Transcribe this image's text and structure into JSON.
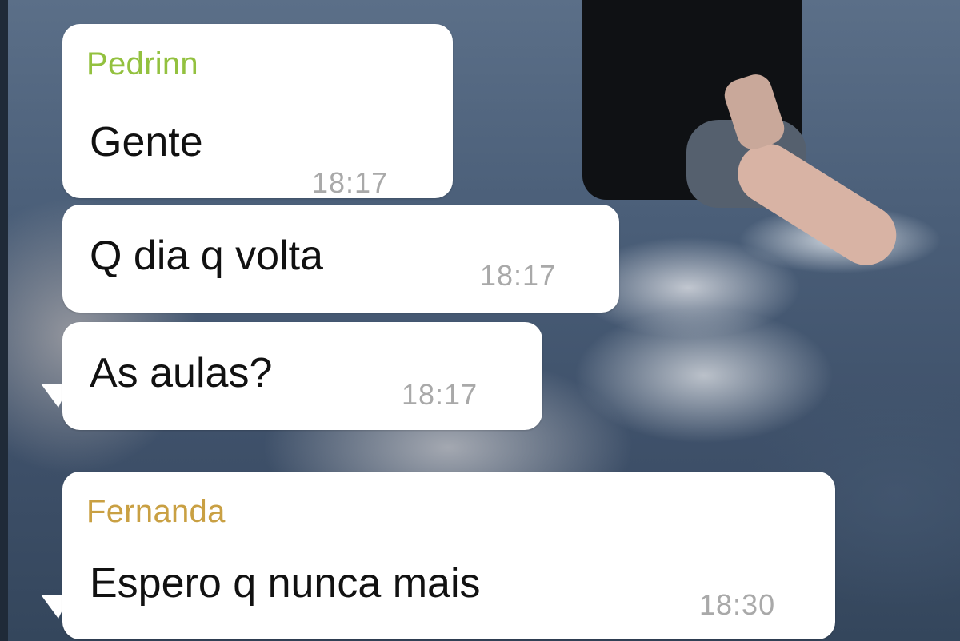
{
  "colors": {
    "bubble_background": "#ffffff",
    "message_text": "#111111",
    "timestamp_text": "#a9a9a9",
    "sender_pedrinn": "#93c13f",
    "sender_fernanda": "#c9a043"
  },
  "messages": [
    {
      "sender": "Pedrinn",
      "text": "Gente",
      "time": "18:17"
    },
    {
      "sender": "",
      "text": "Q dia q volta",
      "time": "18:17"
    },
    {
      "sender": "",
      "text": "As aulas?",
      "time": "18:17"
    },
    {
      "sender": "Fernanda",
      "text": "Espero q nunca mais",
      "time": "18:30"
    }
  ]
}
